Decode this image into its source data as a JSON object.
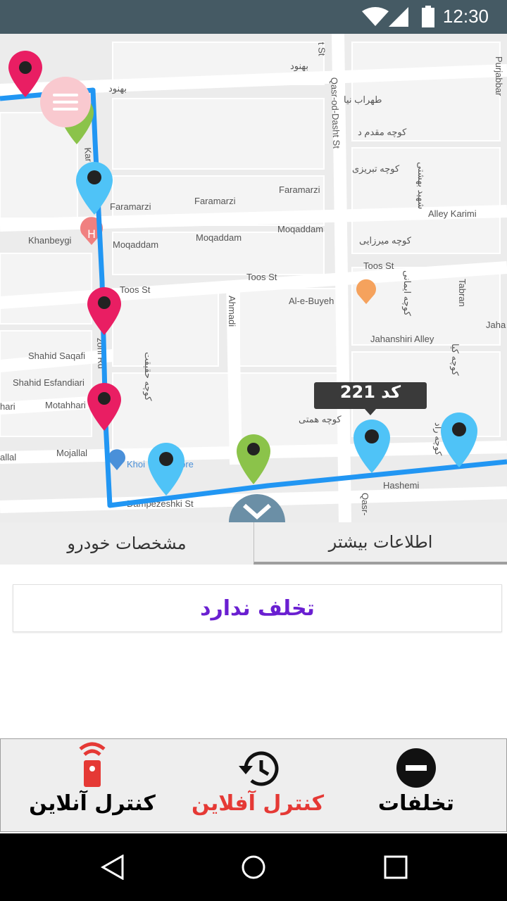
{
  "status_bar": {
    "time": "12:30"
  },
  "map": {
    "street_labels": [
      "Qasr-od-Dasht St",
      "Faramarzi",
      "Faramarzi",
      "Faramarzi",
      "Moqaddam",
      "Moqaddam",
      "Moqaddam",
      "Khanbeygi",
      "Toos St",
      "Toos St",
      "Toos St",
      "Al-e-Buyeh",
      "Ahmadi",
      "Alley Karimi",
      "Jahanshiri Alley",
      "Shahid Saqafi",
      "Shahid Esfandiari",
      "Motahhari",
      "Mojallal",
      "Dampezeshki St",
      "Hashemi",
      "Tabran",
      "Purjabbar",
      "Jaha",
      "Khoi",
      "store",
      "hari",
      "allal",
      "t St",
      "Qasr-",
      "Kar",
      "zoni Rd",
      "بهنود",
      "بهنود",
      "طهراب نیا",
      "کوچه مقدم د",
      "کوچه تبریزی",
      "کوچه میرزایی",
      "کوچه حقیقت",
      "کوچه همتی",
      "شهید بهشتی",
      "کوچه ایمانی",
      "کوچه کیا",
      "کوچه راد"
    ],
    "tooltip": "کد 221",
    "menu_icon": "hamburger-icon",
    "collapse_icon": "chevron-down-icon"
  },
  "tabs": [
    {
      "label": "مشخصات خودرو",
      "active": false
    },
    {
      "label": "اطلاعات بیشتر",
      "active": true
    }
  ],
  "violation_card": {
    "text": "تخلف ندارد",
    "color": "#6a1fd1"
  },
  "bottom_nav": [
    {
      "label": "کنترل آنلاین",
      "icon": "remote-control-icon",
      "color": "#000000"
    },
    {
      "label": "کنترل آفلاین",
      "icon": "history-icon",
      "color": "#e53935"
    },
    {
      "label": "تخلفات",
      "icon": "minus-circle-icon",
      "color": "#000000"
    }
  ],
  "colors": {
    "route": "#2196f3",
    "pin_pink": "#e91e63",
    "pin_green": "#8bc34a",
    "pin_blue": "#4fc3f7",
    "status_bar": "#455a64"
  }
}
